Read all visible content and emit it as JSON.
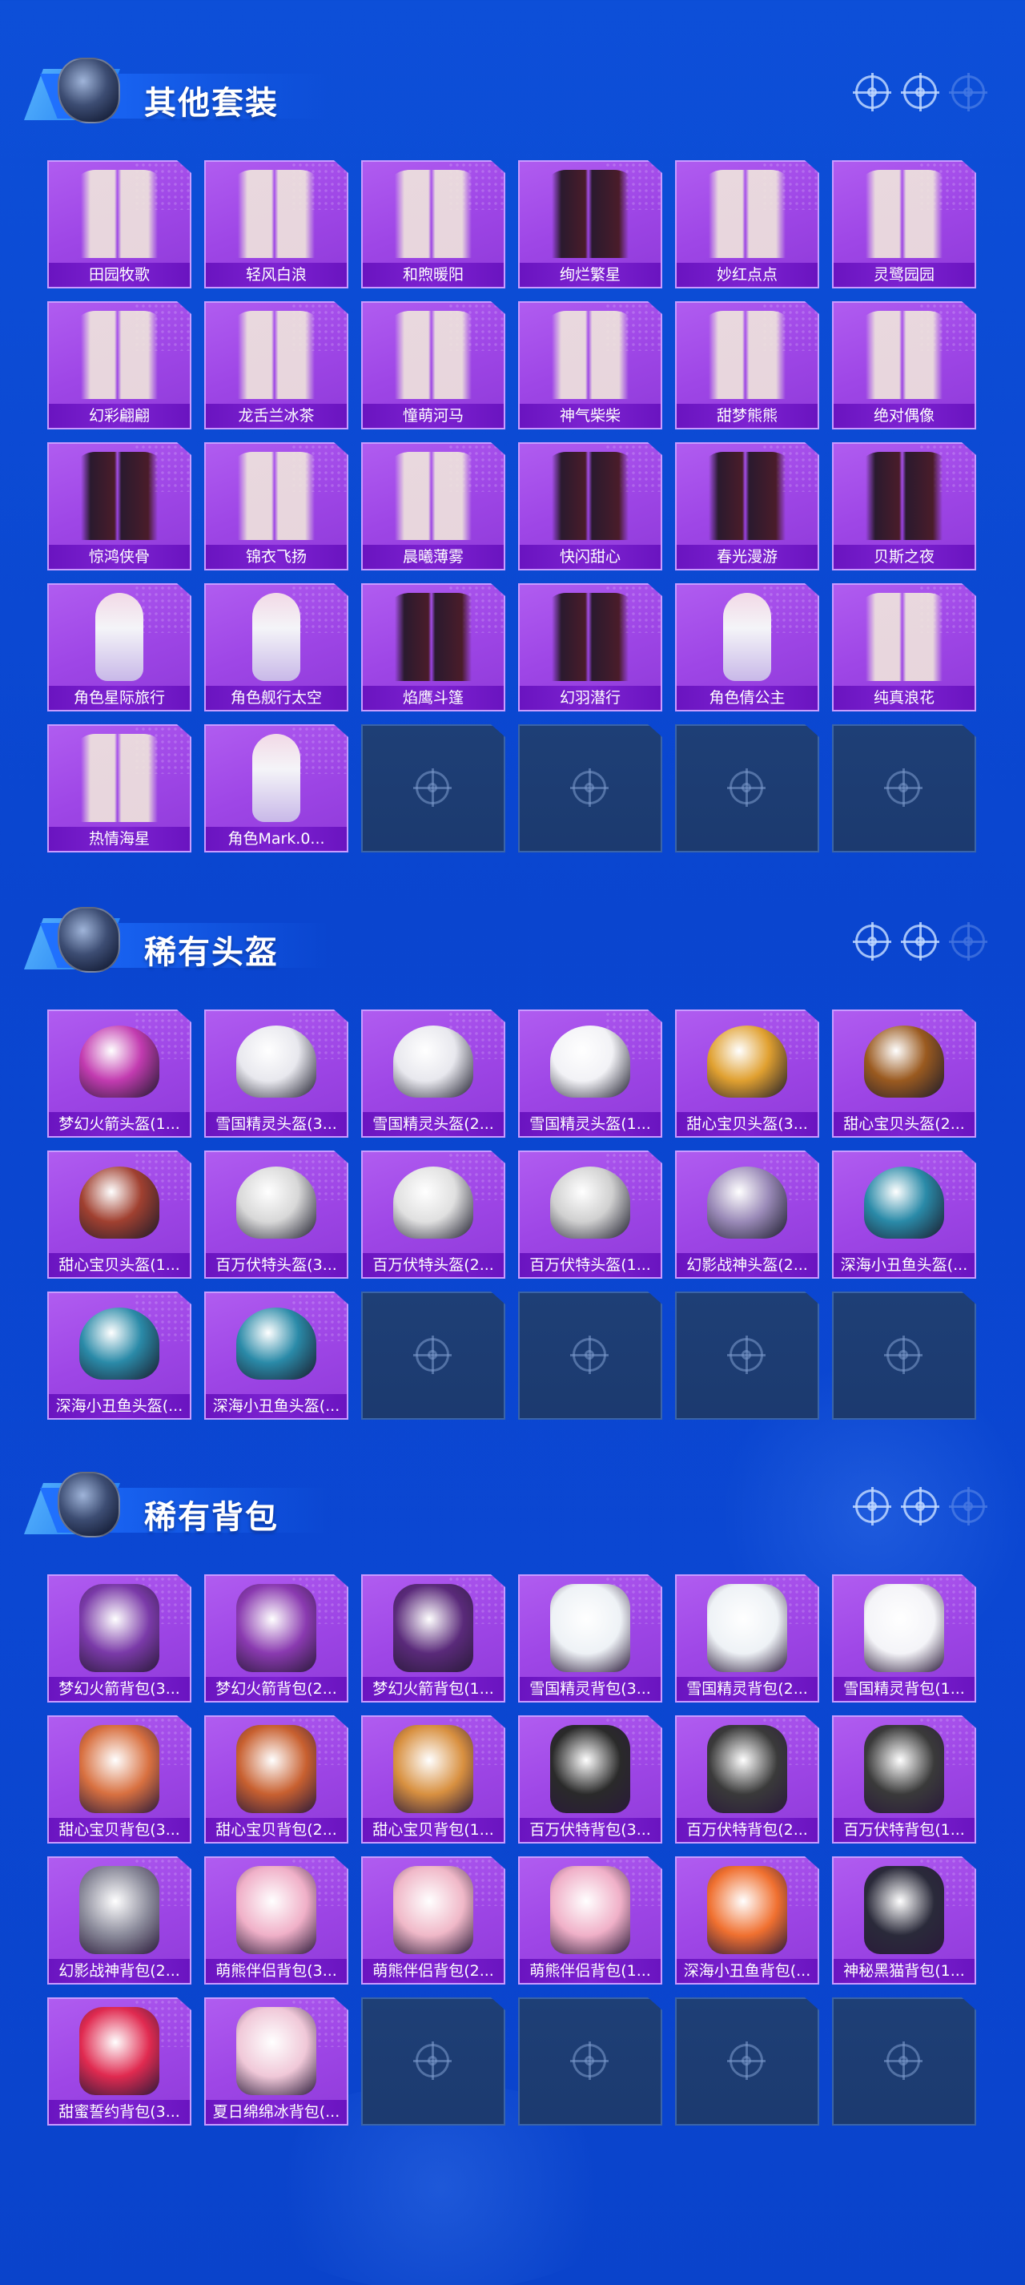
{
  "sections": [
    {
      "title": "其他套装",
      "items": [
        "田园牧歌",
        "轻风白浪",
        "和煦暖阳",
        "绚烂繁星",
        "妙红点点",
        "灵鹭园园",
        "幻彩翩翩",
        "龙舌兰冰茶",
        "憧萌河马",
        "神气柴柴",
        "甜梦熊熊",
        "绝对偶像",
        "惊鸿侠骨",
        "锦衣飞扬",
        "晨曦薄雾",
        "快闪甜心",
        "春光漫游",
        "贝斯之夜",
        "角色星际旅行",
        "角色舰行太空",
        "焰鹰斗篷",
        "幻羽潜行",
        "角色倩公主",
        "纯真浪花",
        "热情海星",
        "角色Mark.0..."
      ],
      "empty_slots": 4
    },
    {
      "title": "稀有头盔",
      "items": [
        "梦幻火箭头盔(1...",
        "雪国精灵头盔(3...",
        "雪国精灵头盔(2...",
        "雪国精灵头盔(1...",
        "甜心宝贝头盔(3...",
        "甜心宝贝头盔(2...",
        "甜心宝贝头盔(1...",
        "百万伏特头盔(3...",
        "百万伏特头盔(2...",
        "百万伏特头盔(1...",
        "幻影战神头盔(2...",
        "深海小丑鱼头盔(...",
        "深海小丑鱼头盔(...",
        "深海小丑鱼头盔(..."
      ],
      "empty_slots": 4
    },
    {
      "title": "稀有背包",
      "items": [
        "梦幻火箭背包(3...",
        "梦幻火箭背包(2...",
        "梦幻火箭背包(1...",
        "雪国精灵背包(3...",
        "雪国精灵背包(2...",
        "雪国精灵背包(1...",
        "甜心宝贝背包(3...",
        "甜心宝贝背包(2...",
        "甜心宝贝背包(1...",
        "百万伏特背包(3...",
        "百万伏特背包(2...",
        "百万伏特背包(1...",
        "幻影战神背包(2...",
        "萌熊伴侣背包(3...",
        "萌熊伴侣背包(2...",
        "萌熊伴侣背包(1...",
        "深海小丑鱼背包(...",
        "神秘黑猫背包(1...",
        "甜蜜誓约背包(3...",
        "夏日绵绵冰背包(..."
      ],
      "empty_slots": 4
    }
  ],
  "icons": {
    "crosshair": "crosshair-icon",
    "avatar": "mascot-avatar-icon"
  },
  "colors": {
    "background": "#0b47d2",
    "item_card": "#a34fe9",
    "item_label_bar": "#7020c8",
    "empty_slot": "#1e3f76"
  }
}
